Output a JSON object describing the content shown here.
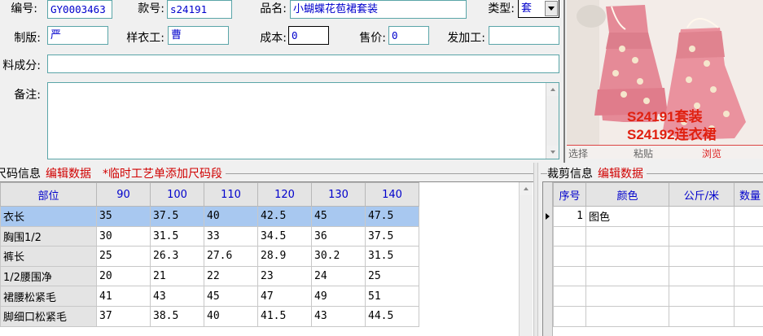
{
  "form": {
    "labels": {
      "code": "编号:",
      "style_no": "款号:",
      "product_name": "品名:",
      "type": "类型:",
      "pattern_maker": "制版:",
      "sample_worker": "样衣工:",
      "cost": "成本:",
      "price": "售价:",
      "processor": "发加工:",
      "material": "料成分:",
      "remark": "备注:"
    },
    "values": {
      "code": "GY0003463",
      "style_no": "s24191",
      "product_name": "小蝴蝶花苞裙套装",
      "type": "套",
      "pattern_maker": "严",
      "sample_worker": "曹",
      "cost": "0",
      "price": "0",
      "processor": "",
      "material": "",
      "remark": ""
    }
  },
  "image_panel": {
    "caption_line1": "S24191套装",
    "caption_line2": "S24192连衣裙",
    "actions": [
      "选择",
      "粘贴",
      "浏览"
    ]
  },
  "size_section": {
    "title": "尺码信息",
    "edit_link": "编辑数据",
    "temp_link": "*临时工艺单添加尺码段",
    "columns": [
      "部位",
      "90",
      "100",
      "110",
      "120",
      "130",
      "140"
    ],
    "rows": [
      [
        "衣长",
        "35",
        "37.5",
        "40",
        "42.5",
        "45",
        "47.5"
      ],
      [
        "胸围1/2",
        "30",
        "31.5",
        "33",
        "34.5",
        "36",
        "37.5"
      ],
      [
        "裤长",
        "25",
        "26.3",
        "27.6",
        "28.9",
        "30.2",
        "31.5"
      ],
      [
        "1/2腰围净",
        "20",
        "21",
        "22",
        "23",
        "24",
        "25"
      ],
      [
        "裙腰松紧毛",
        "41",
        "43",
        "45",
        "47",
        "49",
        "51"
      ],
      [
        "脚细口松紧毛",
        "37",
        "38.5",
        "40",
        "41.5",
        "43",
        "44.5"
      ]
    ]
  },
  "cut_section": {
    "title": "裁剪信息",
    "edit_link": "编辑数据",
    "columns": [
      "序号",
      "颜色",
      "公斤/米",
      "数量"
    ],
    "rows": [
      [
        "1",
        "图色",
        "",
        ""
      ]
    ]
  },
  "colors": {
    "accent_blue": "#0000cc",
    "link_red": "#d00000",
    "selected_row": "#a8c8f0",
    "input_border": "#5aa5a8"
  }
}
